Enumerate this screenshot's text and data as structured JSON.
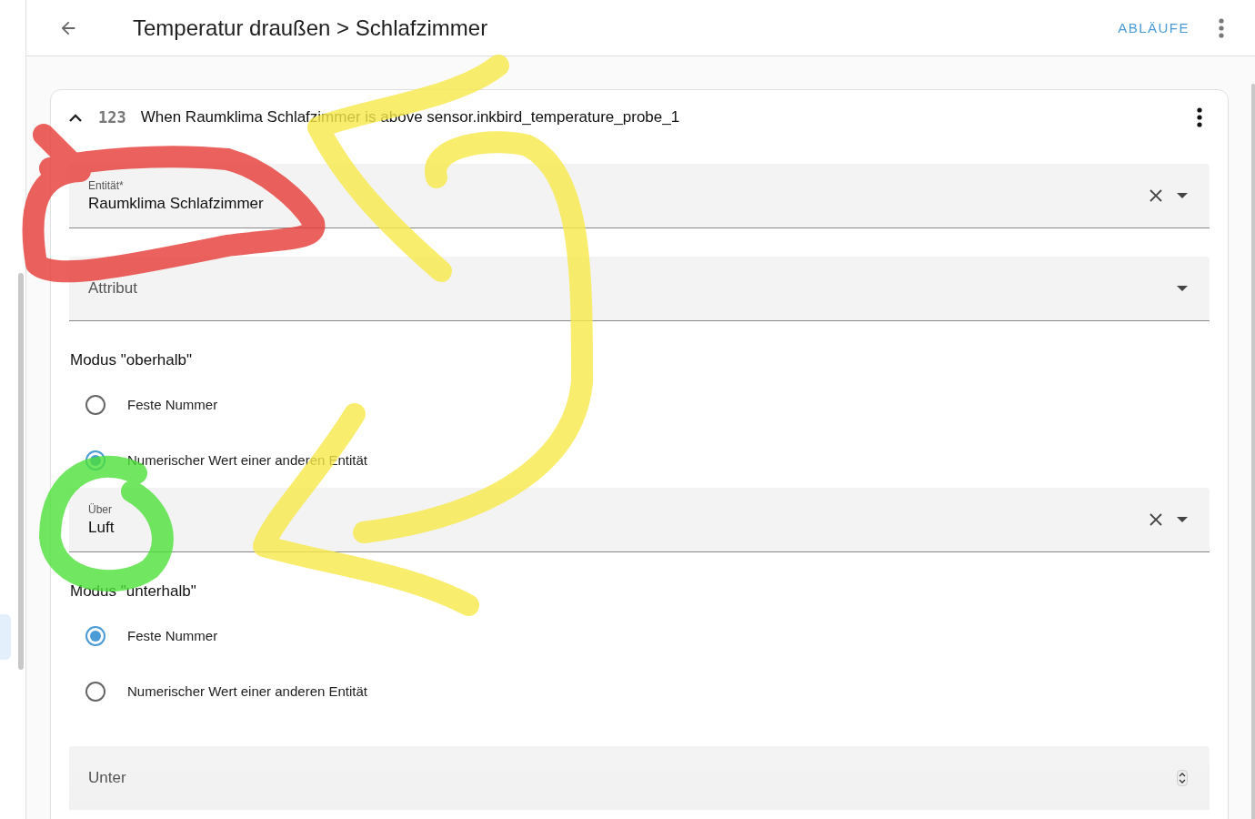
{
  "header": {
    "title": "Temperatur draußen > Schlafzimmer",
    "action": "ABLÄUFE"
  },
  "trigger": {
    "expanded": true,
    "icon_text": "123",
    "title": "When Raumklima Schlafzimmer is above sensor.inkbird_temperature_probe_1"
  },
  "form": [
    {
      "kind": "select",
      "label": "Entität*",
      "value": "Raumklima Schlafzimmer",
      "clearable": true
    },
    {
      "kind": "select",
      "placeholder": "Attribut",
      "clearable": false
    },
    {
      "kind": "radio_group",
      "title": "Modus \"oberhalb\"",
      "options": [
        {
          "label": "Feste Nummer",
          "selected": false
        },
        {
          "label": "Numerischer Wert einer anderen Entität",
          "selected": true
        }
      ]
    },
    {
      "kind": "select",
      "label": "Über",
      "value": "Luft",
      "clearable": true
    },
    {
      "kind": "radio_group",
      "title": "Modus \"unterhalb\"",
      "options": [
        {
          "label": "Feste Nummer",
          "selected": true
        },
        {
          "label": "Numerischer Wert einer anderen Entität",
          "selected": false
        }
      ]
    },
    {
      "kind": "number",
      "placeholder": "Unter"
    }
  ]
}
